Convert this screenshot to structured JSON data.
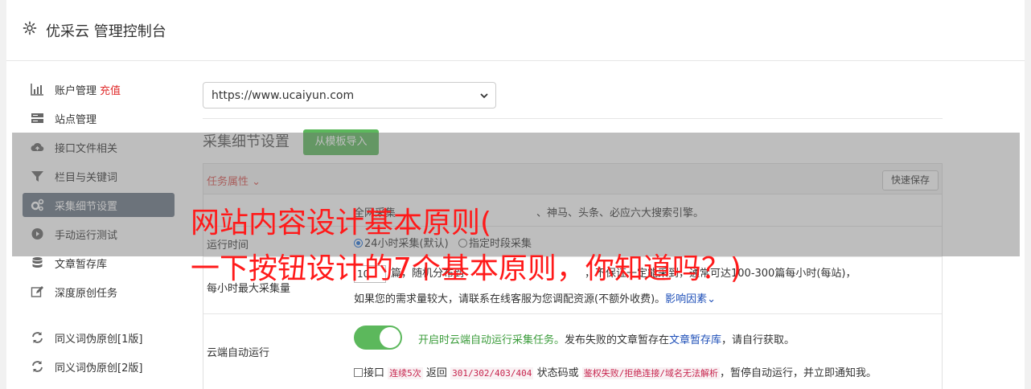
{
  "header": {
    "title": "优采云 管理控制台",
    "icon": "gear-icon"
  },
  "sidebar": {
    "items": [
      {
        "label": "账户管理",
        "extra": "充值",
        "icon": "bar-chart-icon"
      },
      {
        "label": "站点管理",
        "icon": "server-icon"
      },
      {
        "label": "接口文件相关",
        "icon": "cloud-upload-icon"
      },
      {
        "label": "栏目与关键词",
        "icon": "filter-icon"
      },
      {
        "label": "采集细节设置",
        "icon": "cogs-icon",
        "active": true
      },
      {
        "label": "手动运行测试",
        "icon": "play-circle-icon"
      },
      {
        "label": "文章暂存库",
        "icon": "database-icon"
      },
      {
        "label": "深度原创任务",
        "icon": "edit-icon"
      },
      {
        "label": "同义词伪原创[1版]",
        "icon": "refresh-icon"
      },
      {
        "label": "同义词伪原创[2版]",
        "icon": "refresh-icon"
      }
    ]
  },
  "site_select": {
    "value": "https://www.ucaiyun.com"
  },
  "section": {
    "title": "采集细节设置",
    "import_button": "从模板导入"
  },
  "panel": {
    "task_attr": "任务属性",
    "quick_save": "快速保存",
    "row1": {
      "text_a": "全网采集",
      "text_b": "、神马、头条、必应六大搜索引擎。"
    },
    "run_time": {
      "label": "运行时间",
      "opt1": "24小时采集(默认)",
      "opt2": "指定时段采集"
    },
    "max_collect": {
      "label": "每小时最大采集量",
      "value": "10",
      "text1": "篇，随机分布到",
      "text2": "，不保证一定能采到，通常可达100-300篇每小时(每站)，",
      "text3": "如果您的需求量较大，请联系在线客服为您调配资源(不额外收费)。",
      "link": "影响因素"
    },
    "cloud_run": {
      "label": "云端自动运行",
      "green_text": "开启时云端自动运行采集任务。",
      "text_a": "发布失败的文章暂存在",
      "link": "文章暂存库",
      "text_b": "，请自行获取。",
      "chk_a": "接口",
      "code1": "连续5次",
      "chk_b": "返回",
      "code2": "301/302/403/404",
      "chk_c": "状态码或",
      "code3": "鉴权失败/拒绝连接/域名无法解析",
      "chk_d": "，暂停自动运行，并立即通知我。"
    }
  },
  "overlay": {
    "line1": "网站内容设计基本原则(",
    "line2": "一下按钮设计的7个基本原则，你知道吗？)"
  },
  "colors": {
    "accent_green": "#5cb85c",
    "active_nav": "#6b7785",
    "overlay_text": "#ff1a1a"
  }
}
